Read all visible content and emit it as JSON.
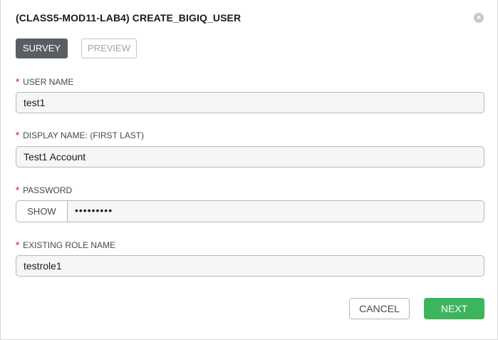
{
  "dialog": {
    "title": "(CLASS5-MOD11-LAB4) CREATE_BIGIQ_USER",
    "close_icon": "close-circle-icon"
  },
  "tabs": [
    {
      "label": "SURVEY",
      "active": true
    },
    {
      "label": "PREVIEW",
      "active": false
    }
  ],
  "fields": {
    "required_marker": "*",
    "user_name": {
      "label": "USER NAME",
      "value": "test1"
    },
    "display_name": {
      "label": "DISPLAY NAME: (FIRST LAST)",
      "value": "Test1 Account"
    },
    "password": {
      "label": "PASSWORD",
      "show_label": "SHOW",
      "value": "•••••••••"
    },
    "existing_role_name": {
      "label": "EXISTING ROLE NAME",
      "value": "testrole1"
    }
  },
  "footer": {
    "cancel_label": "CANCEL",
    "next_label": "NEXT"
  },
  "colors": {
    "required": "#d9534f",
    "primary": "#3cb55c",
    "active_tab": "#5a5e63"
  }
}
